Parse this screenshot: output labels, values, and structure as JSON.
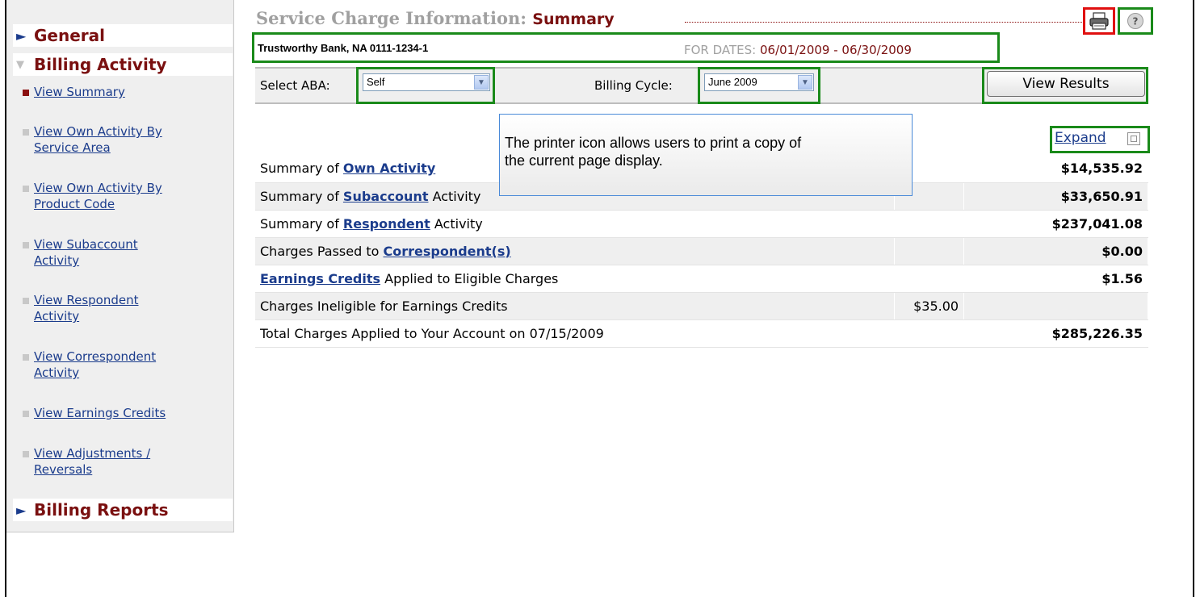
{
  "sidebar": {
    "sections": {
      "general": "General",
      "billing_activity": "Billing Activity",
      "billing_reports": "Billing Reports"
    },
    "items": [
      {
        "label_lines": [
          "View Summary"
        ],
        "active": true
      },
      {
        "label_lines": [
          "View Own Activity By",
          "Service Area"
        ],
        "active": false
      },
      {
        "label_lines": [
          "View Own Activity By",
          "Product Code"
        ],
        "active": false
      },
      {
        "label_lines": [
          "View Subaccount",
          "Activity"
        ],
        "active": false
      },
      {
        "label_lines": [
          "View Respondent",
          "Activity"
        ],
        "active": false
      },
      {
        "label_lines": [
          "View Correspondent",
          "Activity"
        ],
        "active": false
      },
      {
        "label_lines": [
          "View Earnings Credits"
        ],
        "active": false
      },
      {
        "label_lines": [
          "View Adjustments /",
          "Reversals"
        ],
        "active": false
      }
    ]
  },
  "header": {
    "title": "Service Charge Information:",
    "subtitle": "Summary",
    "bank": "Trustworthy Bank, NA 0111-1234-1",
    "for_dates_label": "FOR DATES:",
    "dates": "06/01/2009 - 06/30/2009",
    "print_icon": "printer-icon",
    "help_icon": "help-icon"
  },
  "filters": {
    "aba_label": "Select ABA:",
    "aba_value": "Self",
    "cycle_label": "Billing Cycle:",
    "cycle_value": "June 2009",
    "view_button": "View Results"
  },
  "expand_label": "Expand",
  "tooltip": {
    "line1": "The printer icon allows users to print a copy of",
    "line2": "the current page display."
  },
  "summary_rows": [
    {
      "prefix": "Summary of ",
      "link": "Own Activity",
      "suffix": "",
      "mid": "",
      "amount": "$14,535.92"
    },
    {
      "prefix": "Summary of ",
      "link": "Subaccount",
      "suffix": " Activity",
      "mid": "",
      "amount": "$33,650.91"
    },
    {
      "prefix": "Summary of ",
      "link": "Respondent",
      "suffix": " Activity",
      "mid": "",
      "amount": "$237,041.08"
    },
    {
      "prefix": "Charges Passed to ",
      "link": "Correspondent(s)",
      "suffix": "",
      "mid": "",
      "amount": "$0.00"
    },
    {
      "prefix": "",
      "link": "Earnings Credits",
      "suffix": " Applied to Eligible Charges",
      "mid": "",
      "amount": "$1.56"
    },
    {
      "prefix": "Charges Ineligible for Earnings Credits",
      "link": "",
      "suffix": "",
      "mid": "$35.00",
      "amount": ""
    },
    {
      "prefix": "Total Charges Applied to Your Account on 07/15/2009",
      "link": "",
      "suffix": "",
      "mid": "",
      "amount": "$285,226.35"
    }
  ],
  "colors": {
    "highlight_green": "#1a8a1a",
    "highlight_red": "#e01010",
    "brand_maroon": "#7a1010",
    "link_blue": "#1b3c8c"
  }
}
